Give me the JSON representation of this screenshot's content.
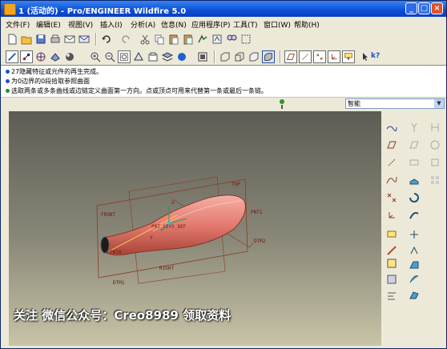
{
  "window": {
    "title": "1 (活动的) - Pro/ENGINEER Wildfire 5.0",
    "buttons": {
      "minimize": "_",
      "maximize": "□",
      "close": "×"
    }
  },
  "menu": [
    "文件(F)",
    "编辑(E)",
    "视图(V)",
    "插入(I)",
    "分析(A)",
    "信息(N)",
    "应用程序(P)",
    "工具(T)",
    "窗口(W)",
    "帮助(H)"
  ],
  "messages": [
    "27隐藏特征或元件的再生完成。",
    "为0边界的0段拾取参照曲面",
    "选取两条或多条曲线或边链定义曲面第一方向。点或顶点可用来代替第一条或最后一条链。"
  ],
  "filter": {
    "value": "智能",
    "arrow": "▼"
  },
  "model_labels": {
    "top": "TOP",
    "front": "FRONT",
    "right": "RIGHT",
    "pnt0": "PNT0",
    "pnt1": "PNT1",
    "dtm1": "DTM1",
    "dtm2": "DTM2",
    "csys": "PRT_CSYS_DEF",
    "axis_x": "X",
    "axis_y": "Y"
  },
  "watermark": "关注 微信公众号：Creo8989 领取资料",
  "help_glyph": "k?",
  "colors": {
    "title_bar": "#0a4fd6",
    "surface": "#e88a80",
    "datum": "#8b3a22",
    "background_top": "#5c5c54",
    "background_bottom": "#c8c4a8"
  }
}
